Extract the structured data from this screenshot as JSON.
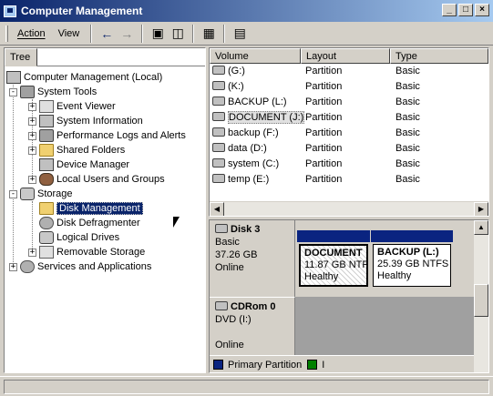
{
  "window": {
    "title": "Computer Management",
    "buttons": {
      "minimize": "_",
      "maximize": "□",
      "close": "×"
    }
  },
  "menu": {
    "action": "Action",
    "view": "View"
  },
  "toolbar_icons": [
    "back-arrow-icon",
    "forward-arrow-icon",
    "up-folder-icon",
    "show-hide-tree-icon",
    "properties-icon",
    "help-icon"
  ],
  "tree": {
    "tab": "Tree",
    "root": "Computer Management (Local)",
    "system_tools": "System Tools",
    "event_viewer": "Event Viewer",
    "system_information": "System Information",
    "perf_logs": "Performance Logs and Alerts",
    "shared_folders": "Shared Folders",
    "device_manager": "Device Manager",
    "local_users": "Local Users and Groups",
    "storage": "Storage",
    "disk_management": "Disk Management",
    "disk_defragmenter": "Disk Defragmenter",
    "logical_drives": "Logical Drives",
    "removable_storage": "Removable Storage",
    "services": "Services and Applications"
  },
  "volumes": {
    "headers": {
      "volume": "Volume",
      "layout": "Layout",
      "type": "Type"
    },
    "rows": [
      {
        "volume": "(G:)",
        "layout": "Partition",
        "type": "Basic"
      },
      {
        "volume": "(K:)",
        "layout": "Partition",
        "type": "Basic"
      },
      {
        "volume": "BACKUP (L:)",
        "layout": "Partition",
        "type": "Basic"
      },
      {
        "volume": "DOCUMENT (J:)",
        "layout": "Partition",
        "type": "Basic"
      },
      {
        "volume": "backup (F:)",
        "layout": "Partition",
        "type": "Basic"
      },
      {
        "volume": "data (D:)",
        "layout": "Partition",
        "type": "Basic"
      },
      {
        "volume": "system (C:)",
        "layout": "Partition",
        "type": "Basic"
      },
      {
        "volume": "temp (E:)",
        "layout": "Partition",
        "type": "Basic"
      }
    ]
  },
  "disks": {
    "disk3": {
      "name": "Disk 3",
      "type": "Basic",
      "size": "37.26 GB",
      "status": "Online"
    },
    "partitions": [
      {
        "name": "DOCUMENT",
        "detail": "11.87 GB NTF",
        "status": "Healthy"
      },
      {
        "name": "BACKUP  (L:)",
        "detail": "25.39 GB NTFS",
        "status": "Healthy"
      }
    ],
    "cdrom": {
      "name": "CDRom 0",
      "drive": "DVD (I:)",
      "status": "Online"
    }
  },
  "legend": {
    "primary": "Primary Partition",
    "second_initial": "I"
  },
  "colors": {
    "primary_partition": "#0a2480",
    "second_legend": "#008000",
    "selection": "#0a246a"
  }
}
